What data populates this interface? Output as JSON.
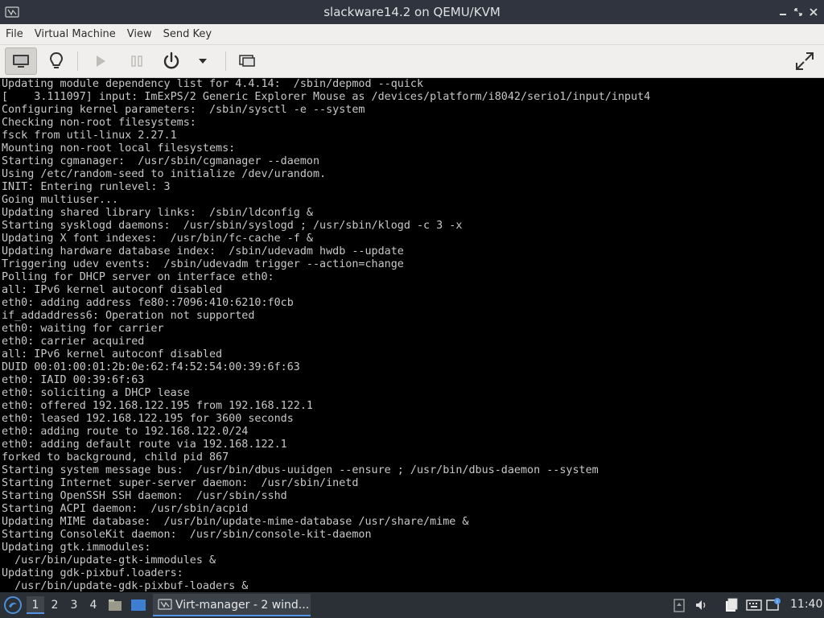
{
  "window": {
    "title": "slackware14.2 on QEMU/KVM"
  },
  "menubar": {
    "items": [
      "File",
      "Virtual Machine",
      "View",
      "Send Key"
    ]
  },
  "toolbar": {
    "buttons": [
      "show-console",
      "show-details",
      "run",
      "pause",
      "shutdown",
      "shutdown-menu",
      "screenshots",
      "fullscreen"
    ]
  },
  "console": {
    "lines": [
      "Updating module dependency list for 4.4.14:  /sbin/depmod --quick",
      "[    3.111097] input: ImExPS/2 Generic Explorer Mouse as /devices/platform/i8042/serio1/input/input4",
      "Configuring kernel parameters:  /sbin/sysctl -e --system",
      "Checking non-root filesystems:",
      "fsck from util-linux 2.27.1",
      "Mounting non-root local filesystems:",
      "Starting cgmanager:  /usr/sbin/cgmanager --daemon",
      "Using /etc/random-seed to initialize /dev/urandom.",
      "INIT: Entering runlevel: 3",
      "Going multiuser...",
      "Updating shared library links:  /sbin/ldconfig &",
      "Starting sysklogd daemons:  /usr/sbin/syslogd ; /usr/sbin/klogd -c 3 -x",
      "Updating X font indexes:  /usr/bin/fc-cache -f &",
      "Updating hardware database index:  /sbin/udevadm hwdb --update",
      "Triggering udev events:  /sbin/udevadm trigger --action=change",
      "Polling for DHCP server on interface eth0:",
      "all: IPv6 kernel autoconf disabled",
      "eth0: adding address fe80::7096:410:6210:f0cb",
      "if_addaddress6: Operation not supported",
      "eth0: waiting for carrier",
      "eth0: carrier acquired",
      "all: IPv6 kernel autoconf disabled",
      "DUID 00:01:00:01:2b:0e:62:f4:52:54:00:39:6f:63",
      "eth0: IAID 00:39:6f:63",
      "eth0: soliciting a DHCP lease",
      "eth0: offered 192.168.122.195 from 192.168.122.1",
      "eth0: leased 192.168.122.195 for 3600 seconds",
      "eth0: adding route to 192.168.122.0/24",
      "eth0: adding default route via 192.168.122.1",
      "forked to background, child pid 867",
      "Starting system message bus:  /usr/bin/dbus-uuidgen --ensure ; /usr/bin/dbus-daemon --system",
      "Starting Internet super-server daemon:  /usr/sbin/inetd",
      "Starting OpenSSH SSH daemon:  /usr/sbin/sshd",
      "Starting ACPI daemon:  /usr/sbin/acpid",
      "Updating MIME database:  /usr/bin/update-mime-database /usr/share/mime &",
      "Starting ConsoleKit daemon:  /usr/sbin/console-kit-daemon",
      "Updating gtk.immodules:",
      "  /usr/bin/update-gtk-immodules &",
      "Updating gdk-pixbuf.loaders:",
      "  /usr/bin/update-gdk-pixbuf-loaders &"
    ]
  },
  "taskbar": {
    "workspaces": [
      "1",
      "2",
      "3",
      "4"
    ],
    "active_workspace": "1",
    "task_label": "Virt-manager - 2 wind...",
    "clock": "11:40"
  },
  "colors": {
    "titlebar_bg": "#2f343f",
    "toolbar_bg": "#f0efed",
    "console_bg": "#000000",
    "console_fg": "#c8c8c8",
    "taskbar_bg": "#2b3036",
    "accent": "#5294e2"
  }
}
